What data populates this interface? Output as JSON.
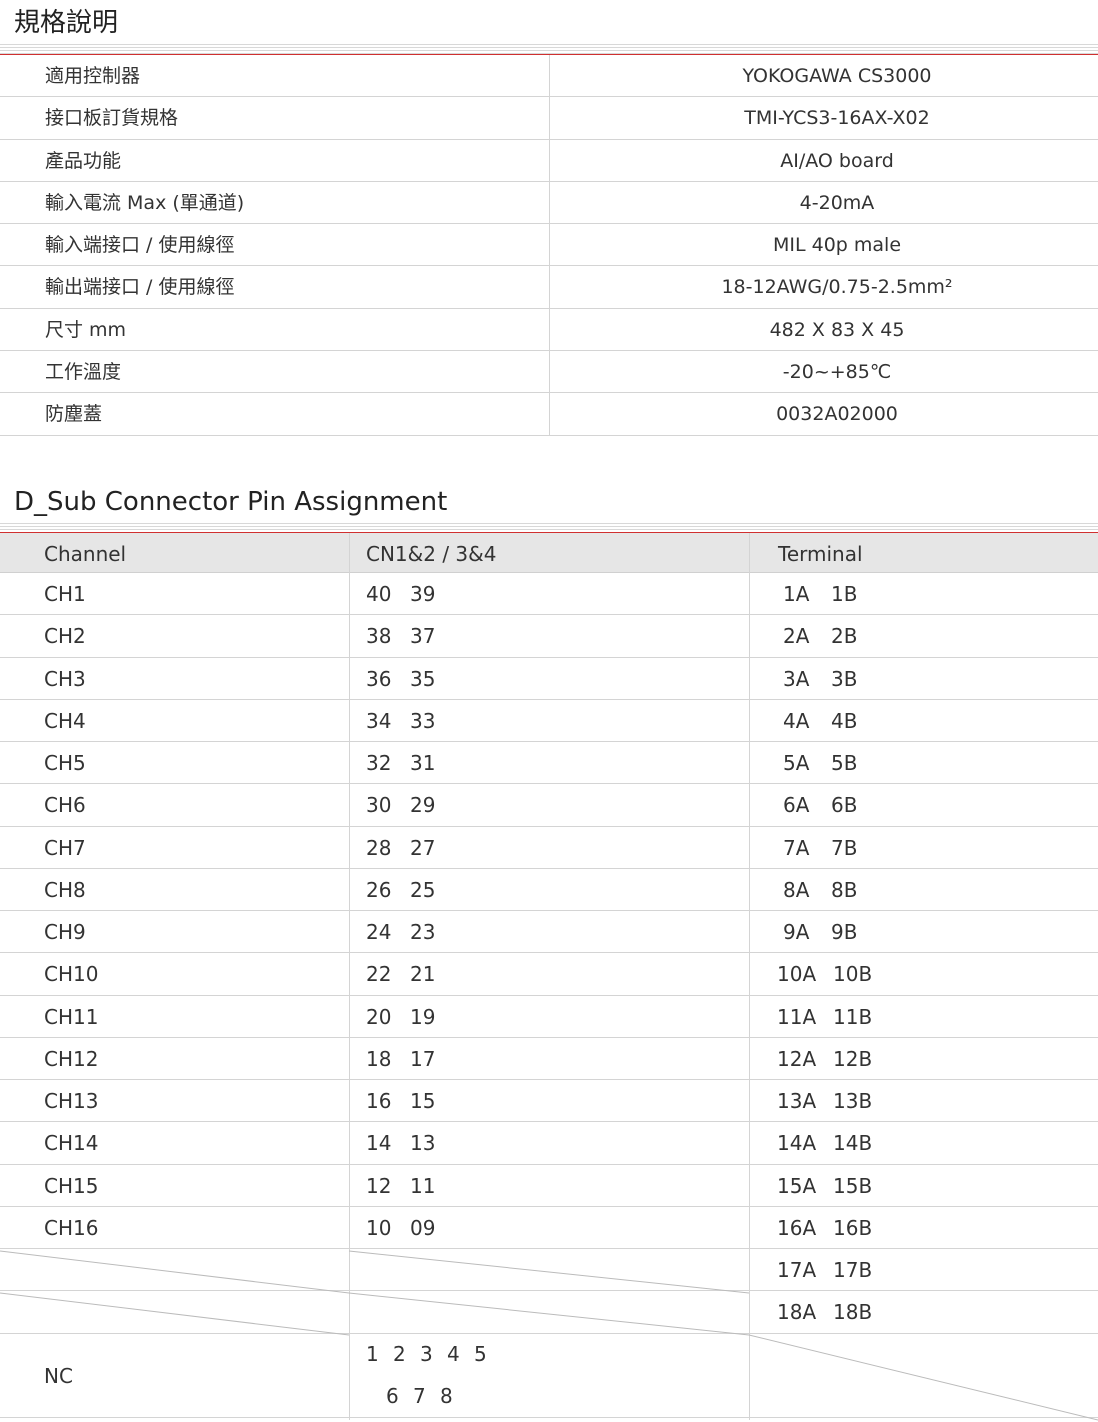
{
  "spec_section": {
    "title": "規格說明",
    "rows": [
      {
        "label": "適用控制器",
        "value": "YOKOGAWA CS3000"
      },
      {
        "label": "接口板訂貨規格",
        "value": "TMI-YCS3-16AX-X02"
      },
      {
        "label": "產品功能",
        "value": "AI/AO board"
      },
      {
        "label": "輸入電流 Max (單通道)",
        "value": "4-20mA"
      },
      {
        "label": "輸入端接口 / 使用線徑",
        "value": "MIL 40p male"
      },
      {
        "label": "輸出端接口 / 使用線徑",
        "value": "18-12AWG/0.75-2.5mm²"
      },
      {
        "label": "尺寸 mm",
        "value": "482 X 83  X 45"
      },
      {
        "label": "工作溫度",
        "value": "-20~+85℃"
      },
      {
        "label": "防塵蓋",
        "value": "0032A02000"
      }
    ]
  },
  "pin_section": {
    "title": "D_Sub Connector Pin Assignment",
    "headers": [
      "Channel",
      "CN1&2 / 3&4",
      "Terminal"
    ],
    "rows": [
      {
        "channel": "CH1",
        "pin_a": "40",
        "pin_b": "39",
        "term_a": "1A",
        "term_b": "1B"
      },
      {
        "channel": "CH2",
        "pin_a": "38",
        "pin_b": "37",
        "term_a": "2A",
        "term_b": "2B"
      },
      {
        "channel": "CH3",
        "pin_a": "36",
        "pin_b": "35",
        "term_a": "3A",
        "term_b": "3B"
      },
      {
        "channel": "CH4",
        "pin_a": "34",
        "pin_b": "33",
        "term_a": "4A",
        "term_b": "4B"
      },
      {
        "channel": "CH5",
        "pin_a": "32",
        "pin_b": "31",
        "term_a": "5A",
        "term_b": "5B"
      },
      {
        "channel": "CH6",
        "pin_a": "30",
        "pin_b": "29",
        "term_a": "6A",
        "term_b": "6B"
      },
      {
        "channel": "CH7",
        "pin_a": "28",
        "pin_b": "27",
        "term_a": "7A",
        "term_b": "7B"
      },
      {
        "channel": "CH8",
        "pin_a": "26",
        "pin_b": "25",
        "term_a": "8A",
        "term_b": "8B"
      },
      {
        "channel": "CH9",
        "pin_a": "24",
        "pin_b": "23",
        "term_a": "9A",
        "term_b": "9B"
      },
      {
        "channel": "CH10",
        "pin_a": "22",
        "pin_b": "21",
        "term_a": "10A",
        "term_b": "10B"
      },
      {
        "channel": "CH11",
        "pin_a": "20",
        "pin_b": "19",
        "term_a": "11A",
        "term_b": "11B"
      },
      {
        "channel": "CH12",
        "pin_a": "18",
        "pin_b": "17",
        "term_a": "12A",
        "term_b": "12B"
      },
      {
        "channel": "CH13",
        "pin_a": "16",
        "pin_b": "15",
        "term_a": "13A",
        "term_b": "13B"
      },
      {
        "channel": "CH14",
        "pin_a": "14",
        "pin_b": "13",
        "term_a": "14A",
        "term_b": "14B"
      },
      {
        "channel": "CH15",
        "pin_a": "12",
        "pin_b": "11",
        "term_a": "15A",
        "term_b": "15B"
      },
      {
        "channel": "CH16",
        "pin_a": "10",
        "pin_b": "09",
        "term_a": "16A",
        "term_b": "16B"
      },
      {
        "channel": "",
        "pin_a": "",
        "pin_b": "",
        "term_a": "17A",
        "term_b": "17B"
      },
      {
        "channel": "",
        "pin_a": "",
        "pin_b": "",
        "term_a": "18A",
        "term_b": "18B"
      }
    ],
    "nc": {
      "label": "NC",
      "pins_line1": [
        "1",
        "2",
        "3",
        "4",
        "5"
      ],
      "pins_line2": [
        "6",
        "7",
        "8"
      ]
    }
  }
}
